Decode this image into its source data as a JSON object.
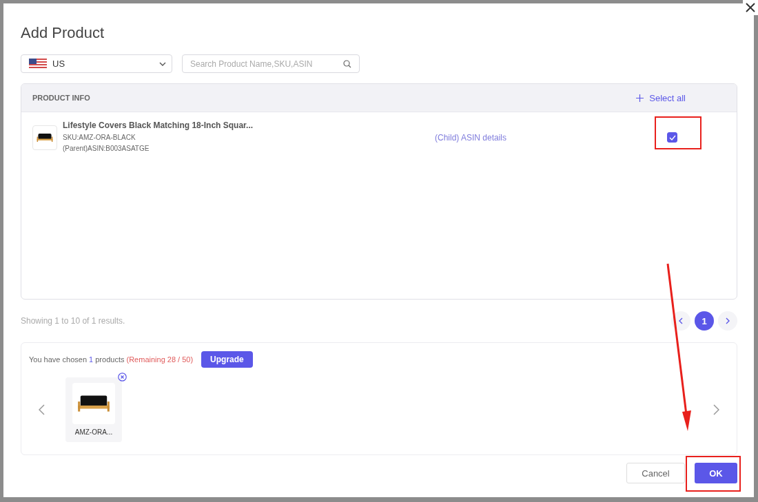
{
  "dialog": {
    "title": "Add Product",
    "marketplace": {
      "value": "US"
    },
    "search": {
      "placeholder": "Search Product Name,SKU,ASIN"
    },
    "table": {
      "columns": [
        "PRODUCT INFO"
      ],
      "select_all": "Select all",
      "rows": [
        {
          "name": "Lifestyle Covers Black Matching 18-Inch Squar...",
          "sku": "SKU:AMZ-ORA-BLACK",
          "parent": "(Parent)ASIN:B003ASATGE",
          "link": "(Child) ASIN details",
          "checked": true
        }
      ]
    },
    "summary": "Showing 1 to 10 of 1 results.",
    "pagination": [
      {
        "label": "1",
        "selected": true
      }
    ],
    "chosen": {
      "prefix": "You have chosen",
      "count": "1",
      "unit": "products",
      "remaining": "(Remaining 28 / 50)",
      "upgrade": "Upgrade",
      "items": [
        {
          "label": "AMZ-ORA..."
        }
      ]
    },
    "buttons": [
      {
        "label": "Cancel",
        "kind": "secondary"
      },
      {
        "label": "OK",
        "kind": "primary"
      }
    ]
  }
}
